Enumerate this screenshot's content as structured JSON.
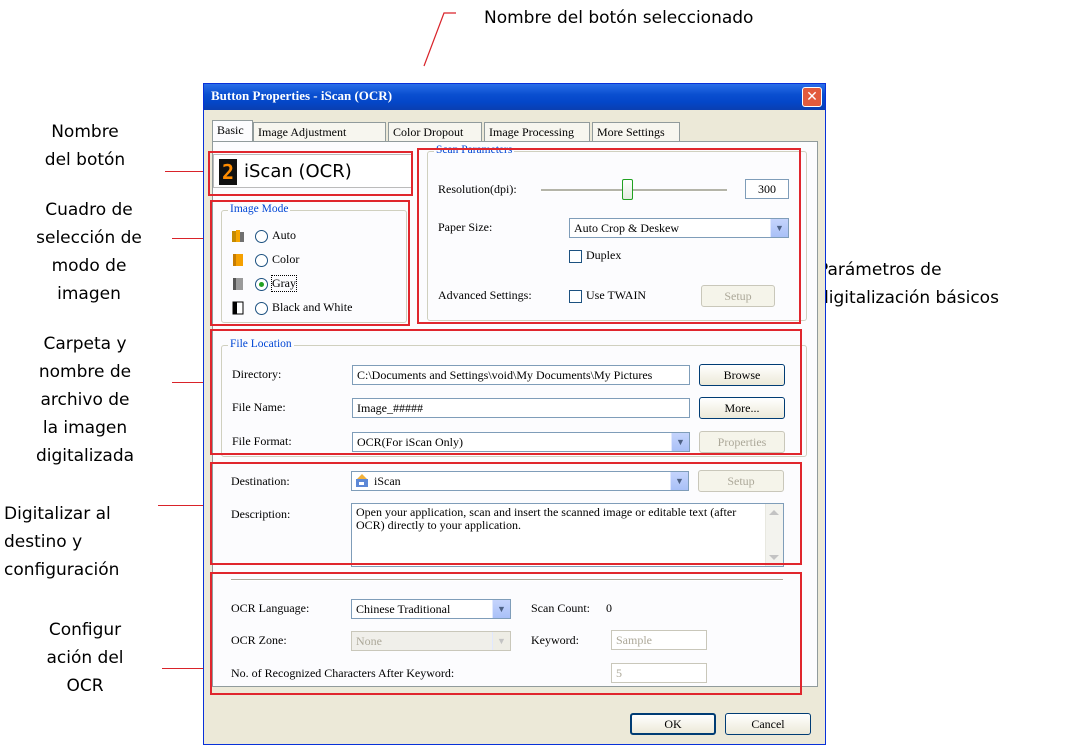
{
  "annotations": {
    "selected_button_name": "Nombre del botón seleccionado",
    "button_name": "Nombre\ndel botón",
    "image_mode_box": "Cuadro de\nselección de\nmodo de\nimagen",
    "basic_scan_params": "Parámetros de\ndigitalización básicos",
    "folder_and_filename": "Carpeta y\nnombre de\narchivo de\nla imagen\ndigitalizada",
    "scan_to_destination": "Digitalizar al\ndestino y\nconfiguración",
    "ocr_configuration": "Configur\nación del\nOCR"
  },
  "window": {
    "title": "Button Properties - iScan (OCR)",
    "close": "✕"
  },
  "tabs": [
    "Basic",
    "Image Adjustment",
    "Color Dropout",
    "Image Processing",
    "More Settings"
  ],
  "button_name_display": {
    "number": "2",
    "name": "iScan (OCR)"
  },
  "image_mode": {
    "title": "Image Mode",
    "options": [
      "Auto",
      "Color",
      "Gray",
      "Black and White"
    ],
    "selected": "Gray"
  },
  "scan_parameters": {
    "title": "Scan Parameters",
    "resolution_label": "Resolution(dpi):",
    "resolution_value": "300",
    "resolution_fraction": 0.46,
    "paper_size_label": "Paper Size:",
    "paper_size_value": "Auto Crop & Deskew",
    "duplex_label": "Duplex",
    "duplex_checked": false,
    "advanced_label": "Advanced Settings:",
    "use_twain_label": "Use TWAIN",
    "use_twain_checked": false,
    "setup_label": "Setup"
  },
  "file_location": {
    "title": "File Location",
    "directory_label": "Directory:",
    "directory_value": "C:\\Documents and Settings\\void\\My Documents\\My Pictures",
    "browse_label": "Browse",
    "file_name_label": "File Name:",
    "file_name_value": "Image_#####",
    "more_label": "More...",
    "file_format_label": "File Format:",
    "file_format_value": "OCR(For iScan Only)",
    "properties_label": "Properties"
  },
  "destination": {
    "destination_label": "Destination:",
    "destination_value": "iScan",
    "setup_label": "Setup",
    "description_label": "Description:",
    "description_value": "Open your application, scan and insert the scanned image or editable text (after OCR) directly to your application."
  },
  "ocr": {
    "language_label": "OCR Language:",
    "language_value": "Chinese Traditional",
    "scan_count_label": "Scan Count:",
    "scan_count_value": "0",
    "zone_label": "OCR Zone:",
    "zone_value": "None",
    "keyword_label": "Keyword:",
    "keyword_value": "Sample",
    "recognized_label": "No. of Recognized Characters After Keyword:",
    "recognized_value": "5"
  },
  "footer": {
    "ok_label": "OK",
    "cancel_label": "Cancel"
  }
}
